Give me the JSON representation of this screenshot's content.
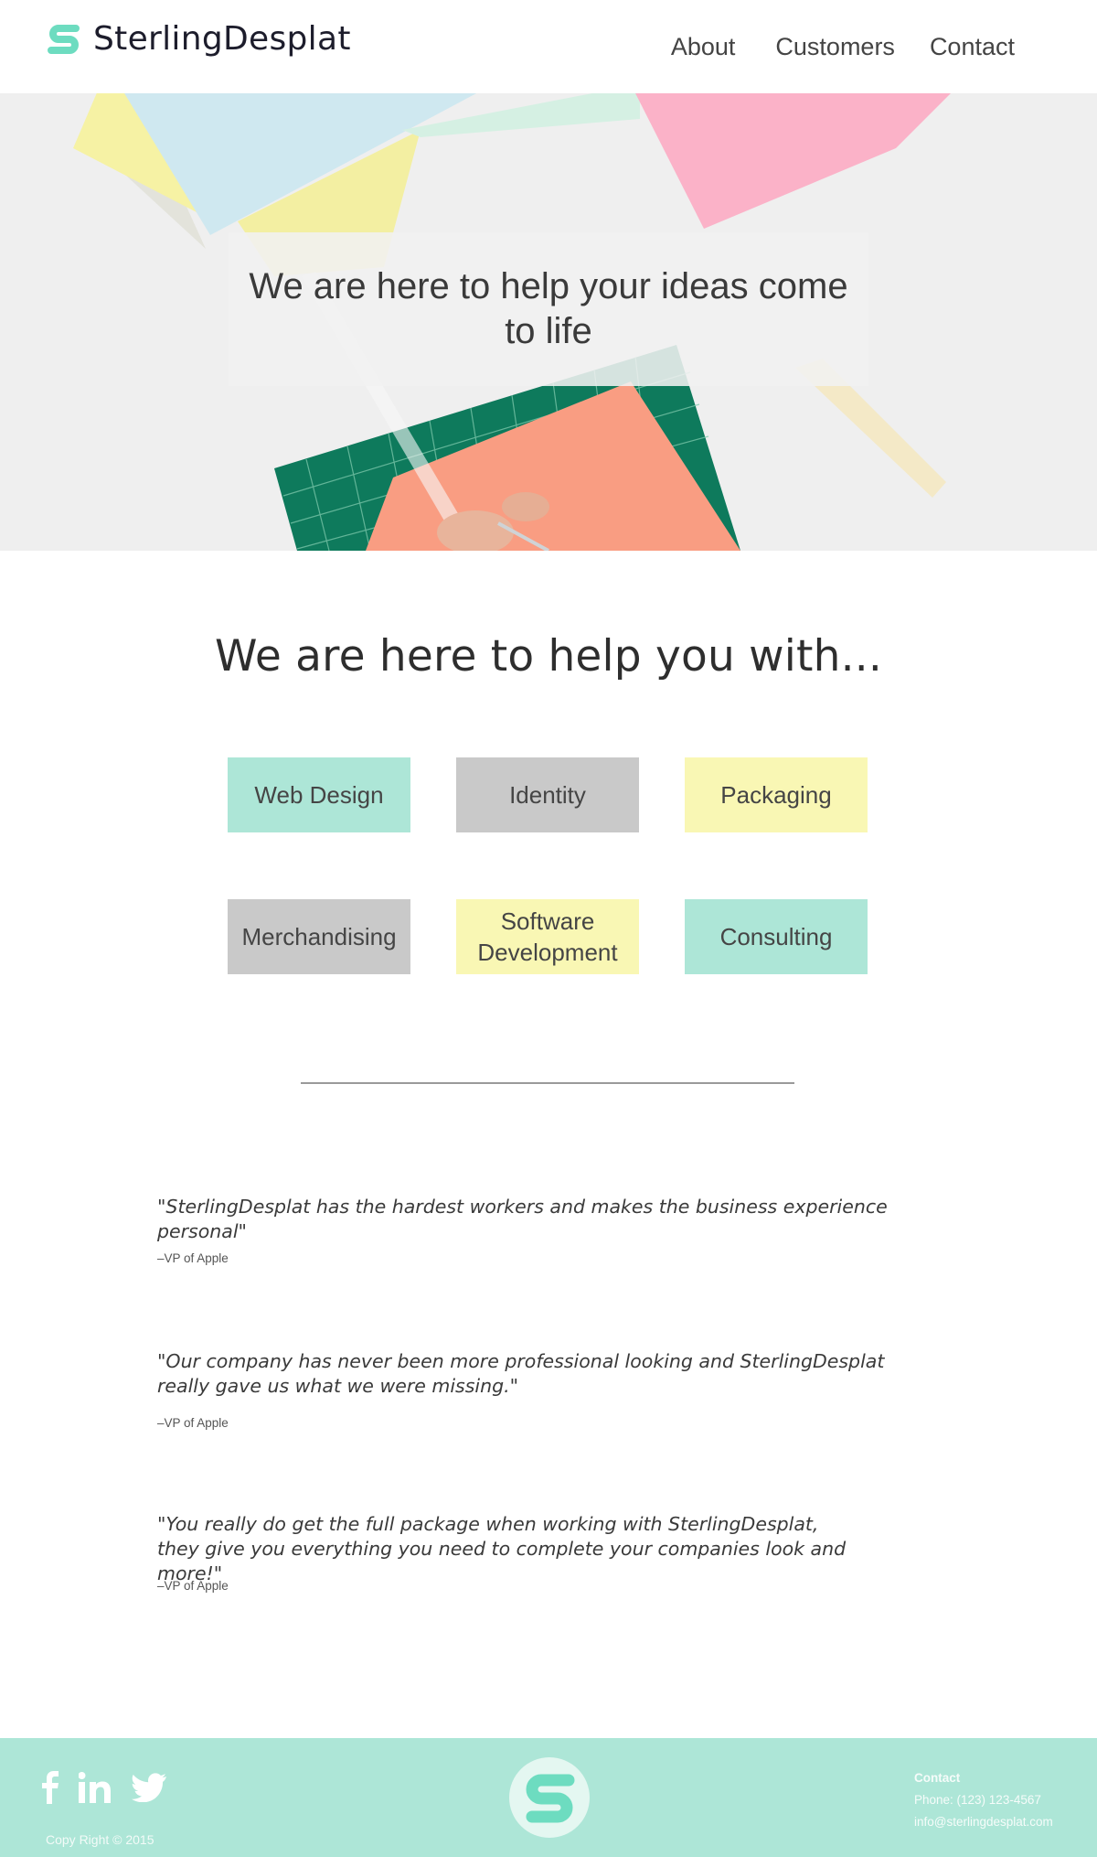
{
  "brand": {
    "name": "SterlingDesplat",
    "accent_color": "#6ddcc0",
    "logo_icon": "sd-monogram-icon"
  },
  "nav": {
    "about": "About",
    "customers": "Customers",
    "contact": "Contact"
  },
  "hero": {
    "title": "We are here to help your ideas come to life",
    "image": "desk-paper-cutting-mat-illustration"
  },
  "services": {
    "title": "We are here to help you with...",
    "items": [
      {
        "label": "Web Design",
        "color": "#ade6d7"
      },
      {
        "label": "Identity",
        "color": "#c9c9c9"
      },
      {
        "label": "Packaging",
        "color": "#f9f7b4"
      },
      {
        "label": "Merchandising",
        "color": "#c9c9c9"
      },
      {
        "label": "Software Development",
        "color": "#f9f7b4"
      },
      {
        "label": "Consulting",
        "color": "#ade6d7"
      }
    ]
  },
  "testimonials": [
    {
      "quote": "\"SterlingDesplat has the hardest workers and makes the business experience personal\"",
      "author": "–VP of Apple"
    },
    {
      "quote": "\"Our company has never been more professional looking and SterlingDesplat really gave us what we were missing.\"",
      "author": "–VP of Apple"
    },
    {
      "quote": "\"You really do get the full package when working with SterlingDesplat, they give you everything you need to complete your companies look and more!\"",
      "author": "–VP of Apple"
    }
  ],
  "footer": {
    "background": "#ade6d7",
    "social_icons": [
      "facebook-icon",
      "linkedin-icon",
      "twitter-icon"
    ],
    "copyright": "Copy Right © 2015",
    "contact_title": "Contact",
    "phone": "Phone: (123) 123-4567",
    "email": "info@sterlingdesplat.com"
  }
}
